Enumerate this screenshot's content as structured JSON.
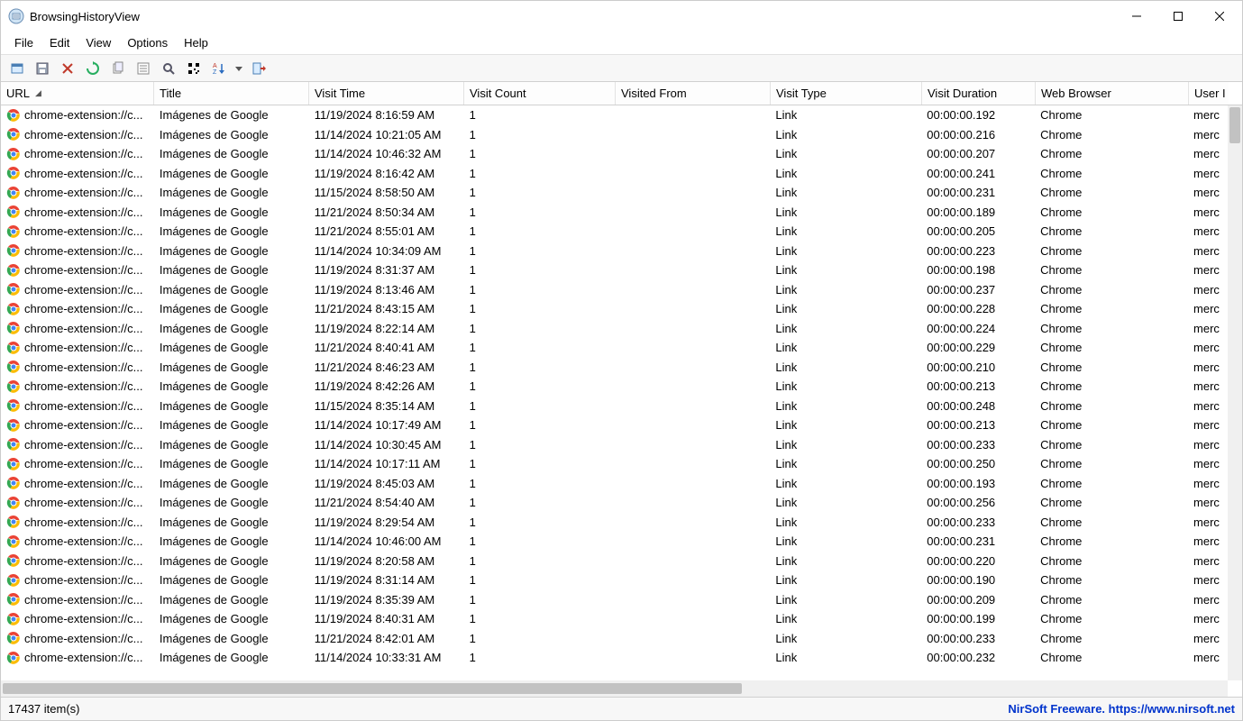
{
  "window": {
    "title": "BrowsingHistoryView"
  },
  "menu": {
    "file": "File",
    "edit": "Edit",
    "view": "View",
    "options": "Options",
    "help": "Help"
  },
  "toolbar_icons": {
    "open": "open-icon",
    "save": "save-icon",
    "delete": "delete-icon",
    "refresh": "refresh-icon",
    "copy": "copy-icon",
    "cut": "cut-icon",
    "find": "find-icon",
    "qr": "qr-icon",
    "sort": "sort-icon",
    "dropdown": "dropdown-icon",
    "export": "export-icon"
  },
  "columns": {
    "url": "URL",
    "title": "Title",
    "visit_time": "Visit Time",
    "visit_count": "Visit Count",
    "visited_from": "Visited From",
    "visit_type": "Visit Type",
    "visit_duration": "Visit Duration",
    "web_browser": "Web Browser",
    "user": "User I"
  },
  "rows": [
    {
      "url": "chrome-extension://c...",
      "title": "Imágenes de Google",
      "time": "11/19/2024 8:16:59 AM",
      "count": "1",
      "from": "",
      "type": "Link",
      "dur": "00:00:00.192",
      "browser": "Chrome",
      "user": "merc"
    },
    {
      "url": "chrome-extension://c...",
      "title": "Imágenes de Google",
      "time": "11/14/2024 10:21:05 AM",
      "count": "1",
      "from": "",
      "type": "Link",
      "dur": "00:00:00.216",
      "browser": "Chrome",
      "user": "merc"
    },
    {
      "url": "chrome-extension://c...",
      "title": "Imágenes de Google",
      "time": "11/14/2024 10:46:32 AM",
      "count": "1",
      "from": "",
      "type": "Link",
      "dur": "00:00:00.207",
      "browser": "Chrome",
      "user": "merc"
    },
    {
      "url": "chrome-extension://c...",
      "title": "Imágenes de Google",
      "time": "11/19/2024 8:16:42 AM",
      "count": "1",
      "from": "",
      "type": "Link",
      "dur": "00:00:00.241",
      "browser": "Chrome",
      "user": "merc"
    },
    {
      "url": "chrome-extension://c...",
      "title": "Imágenes de Google",
      "time": "11/15/2024 8:58:50 AM",
      "count": "1",
      "from": "",
      "type": "Link",
      "dur": "00:00:00.231",
      "browser": "Chrome",
      "user": "merc"
    },
    {
      "url": "chrome-extension://c...",
      "title": "Imágenes de Google",
      "time": "11/21/2024 8:50:34 AM",
      "count": "1",
      "from": "",
      "type": "Link",
      "dur": "00:00:00.189",
      "browser": "Chrome",
      "user": "merc"
    },
    {
      "url": "chrome-extension://c...",
      "title": "Imágenes de Google",
      "time": "11/21/2024 8:55:01 AM",
      "count": "1",
      "from": "",
      "type": "Link",
      "dur": "00:00:00.205",
      "browser": "Chrome",
      "user": "merc"
    },
    {
      "url": "chrome-extension://c...",
      "title": "Imágenes de Google",
      "time": "11/14/2024 10:34:09 AM",
      "count": "1",
      "from": "",
      "type": "Link",
      "dur": "00:00:00.223",
      "browser": "Chrome",
      "user": "merc"
    },
    {
      "url": "chrome-extension://c...",
      "title": "Imágenes de Google",
      "time": "11/19/2024 8:31:37 AM",
      "count": "1",
      "from": "",
      "type": "Link",
      "dur": "00:00:00.198",
      "browser": "Chrome",
      "user": "merc"
    },
    {
      "url": "chrome-extension://c...",
      "title": "Imágenes de Google",
      "time": "11/19/2024 8:13:46 AM",
      "count": "1",
      "from": "",
      "type": "Link",
      "dur": "00:00:00.237",
      "browser": "Chrome",
      "user": "merc"
    },
    {
      "url": "chrome-extension://c...",
      "title": "Imágenes de Google",
      "time": "11/21/2024 8:43:15 AM",
      "count": "1",
      "from": "",
      "type": "Link",
      "dur": "00:00:00.228",
      "browser": "Chrome",
      "user": "merc"
    },
    {
      "url": "chrome-extension://c...",
      "title": "Imágenes de Google",
      "time": "11/19/2024 8:22:14 AM",
      "count": "1",
      "from": "",
      "type": "Link",
      "dur": "00:00:00.224",
      "browser": "Chrome",
      "user": "merc"
    },
    {
      "url": "chrome-extension://c...",
      "title": "Imágenes de Google",
      "time": "11/21/2024 8:40:41 AM",
      "count": "1",
      "from": "",
      "type": "Link",
      "dur": "00:00:00.229",
      "browser": "Chrome",
      "user": "merc"
    },
    {
      "url": "chrome-extension://c...",
      "title": "Imágenes de Google",
      "time": "11/21/2024 8:46:23 AM",
      "count": "1",
      "from": "",
      "type": "Link",
      "dur": "00:00:00.210",
      "browser": "Chrome",
      "user": "merc"
    },
    {
      "url": "chrome-extension://c...",
      "title": "Imágenes de Google",
      "time": "11/19/2024 8:42:26 AM",
      "count": "1",
      "from": "",
      "type": "Link",
      "dur": "00:00:00.213",
      "browser": "Chrome",
      "user": "merc"
    },
    {
      "url": "chrome-extension://c...",
      "title": "Imágenes de Google",
      "time": "11/15/2024 8:35:14 AM",
      "count": "1",
      "from": "",
      "type": "Link",
      "dur": "00:00:00.248",
      "browser": "Chrome",
      "user": "merc"
    },
    {
      "url": "chrome-extension://c...",
      "title": "Imágenes de Google",
      "time": "11/14/2024 10:17:49 AM",
      "count": "1",
      "from": "",
      "type": "Link",
      "dur": "00:00:00.213",
      "browser": "Chrome",
      "user": "merc"
    },
    {
      "url": "chrome-extension://c...",
      "title": "Imágenes de Google",
      "time": "11/14/2024 10:30:45 AM",
      "count": "1",
      "from": "",
      "type": "Link",
      "dur": "00:00:00.233",
      "browser": "Chrome",
      "user": "merc"
    },
    {
      "url": "chrome-extension://c...",
      "title": "Imágenes de Google",
      "time": "11/14/2024 10:17:11 AM",
      "count": "1",
      "from": "",
      "type": "Link",
      "dur": "00:00:00.250",
      "browser": "Chrome",
      "user": "merc"
    },
    {
      "url": "chrome-extension://c...",
      "title": "Imágenes de Google",
      "time": "11/19/2024 8:45:03 AM",
      "count": "1",
      "from": "",
      "type": "Link",
      "dur": "00:00:00.193",
      "browser": "Chrome",
      "user": "merc"
    },
    {
      "url": "chrome-extension://c...",
      "title": "Imágenes de Google",
      "time": "11/21/2024 8:54:40 AM",
      "count": "1",
      "from": "",
      "type": "Link",
      "dur": "00:00:00.256",
      "browser": "Chrome",
      "user": "merc"
    },
    {
      "url": "chrome-extension://c...",
      "title": "Imágenes de Google",
      "time": "11/19/2024 8:29:54 AM",
      "count": "1",
      "from": "",
      "type": "Link",
      "dur": "00:00:00.233",
      "browser": "Chrome",
      "user": "merc"
    },
    {
      "url": "chrome-extension://c...",
      "title": "Imágenes de Google",
      "time": "11/14/2024 10:46:00 AM",
      "count": "1",
      "from": "",
      "type": "Link",
      "dur": "00:00:00.231",
      "browser": "Chrome",
      "user": "merc"
    },
    {
      "url": "chrome-extension://c...",
      "title": "Imágenes de Google",
      "time": "11/19/2024 8:20:58 AM",
      "count": "1",
      "from": "",
      "type": "Link",
      "dur": "00:00:00.220",
      "browser": "Chrome",
      "user": "merc"
    },
    {
      "url": "chrome-extension://c...",
      "title": "Imágenes de Google",
      "time": "11/19/2024 8:31:14 AM",
      "count": "1",
      "from": "",
      "type": "Link",
      "dur": "00:00:00.190",
      "browser": "Chrome",
      "user": "merc"
    },
    {
      "url": "chrome-extension://c...",
      "title": "Imágenes de Google",
      "time": "11/19/2024 8:35:39 AM",
      "count": "1",
      "from": "",
      "type": "Link",
      "dur": "00:00:00.209",
      "browser": "Chrome",
      "user": "merc"
    },
    {
      "url": "chrome-extension://c...",
      "title": "Imágenes de Google",
      "time": "11/19/2024 8:40:31 AM",
      "count": "1",
      "from": "",
      "type": "Link",
      "dur": "00:00:00.199",
      "browser": "Chrome",
      "user": "merc"
    },
    {
      "url": "chrome-extension://c...",
      "title": "Imágenes de Google",
      "time": "11/21/2024 8:42:01 AM",
      "count": "1",
      "from": "",
      "type": "Link",
      "dur": "00:00:00.233",
      "browser": "Chrome",
      "user": "merc"
    },
    {
      "url": "chrome-extension://c...",
      "title": "Imágenes de Google",
      "time": "11/14/2024 10:33:31 AM",
      "count": "1",
      "from": "",
      "type": "Link",
      "dur": "00:00:00.232",
      "browser": "Chrome",
      "user": "merc"
    }
  ],
  "status": {
    "count": "17437 item(s)",
    "credit": "NirSoft Freeware. https://www.nirsoft.net"
  }
}
